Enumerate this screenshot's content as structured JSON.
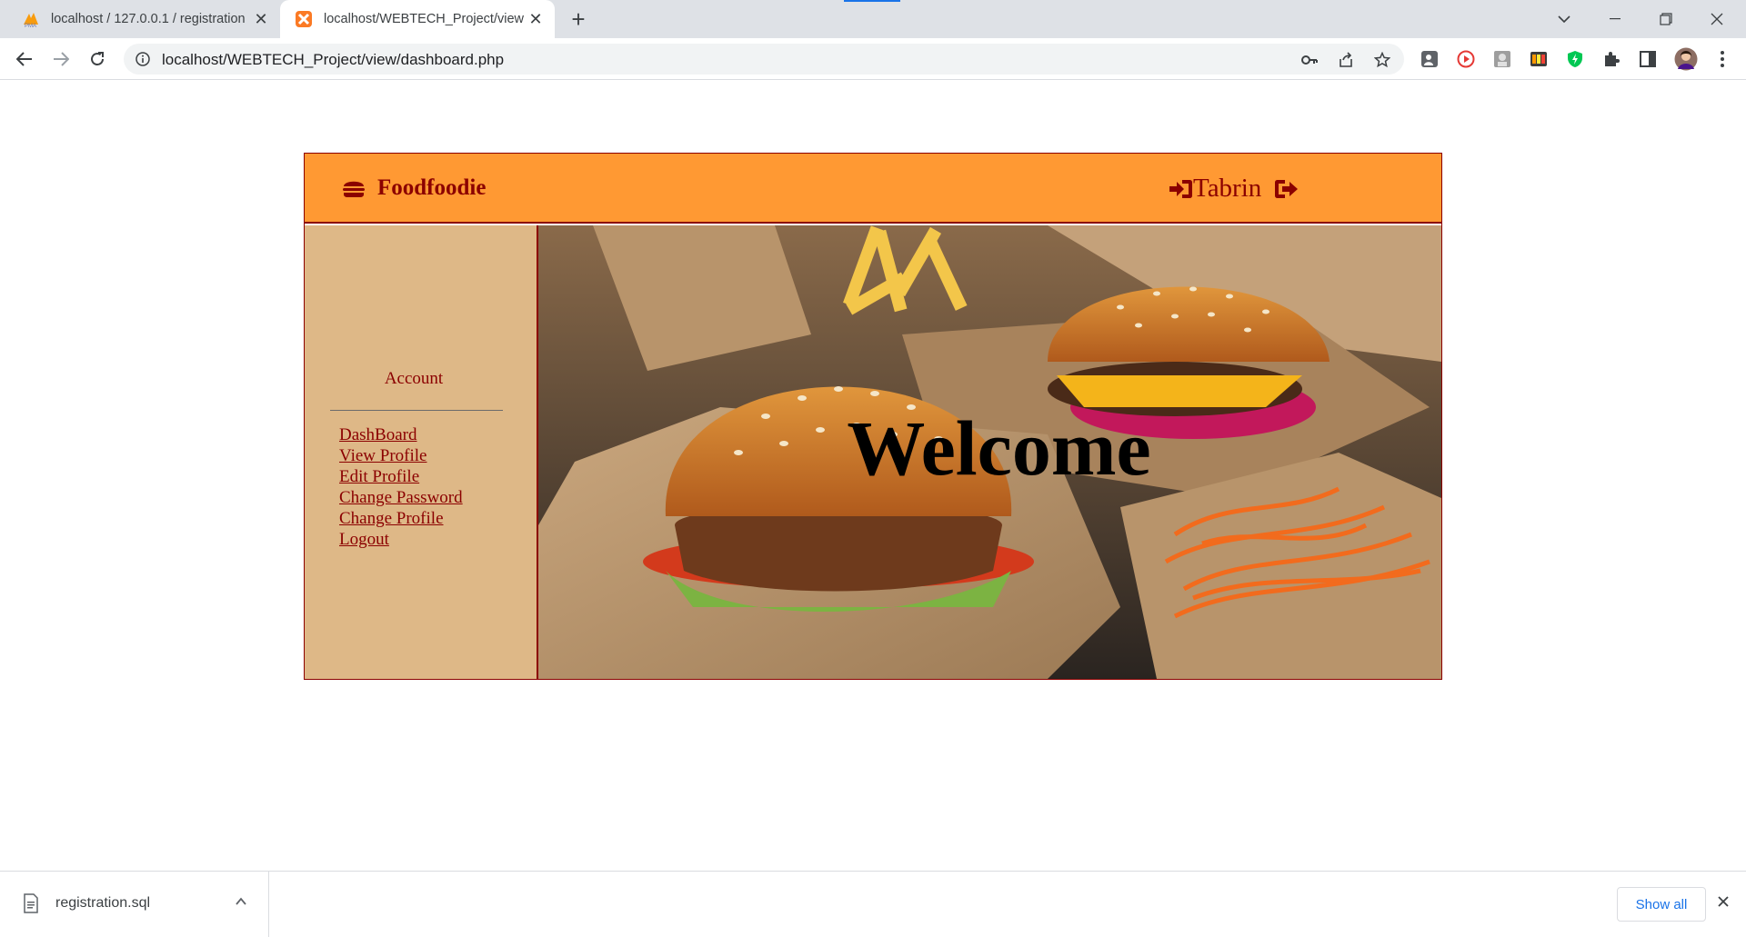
{
  "browser": {
    "tabs": [
      {
        "title": "localhost / 127.0.0.1 / registration",
        "favicon": "phpmyadmin-icon",
        "active": false
      },
      {
        "title": "localhost/WEBTECH_Project/view",
        "favicon": "xampp-icon",
        "active": true
      }
    ],
    "new_tab_label": "+",
    "url": "localhost/WEBTECH_Project/view/dashboard.php",
    "accent": "#1a73e8"
  },
  "site": {
    "brand_name": "Foodfoodie",
    "brand_icon": "burger-icon",
    "user_name": "Tabrin",
    "login_icon": "sign-in-icon",
    "logout_icon": "sign-out-icon",
    "colors": {
      "header": "#ff9933",
      "sidebar": "#deb887",
      "accent": "#8b0000"
    }
  },
  "sidebar": {
    "title": "Account",
    "links": [
      {
        "label": "DashBoard"
      },
      {
        "label": "View Profile"
      },
      {
        "label": "Edit Profile"
      },
      {
        "label": "Change Password"
      },
      {
        "label": "Change Profile"
      },
      {
        "label": "Logout"
      }
    ]
  },
  "main": {
    "heading": "Welcome",
    "image": "burgers-in-kraft-boxes"
  },
  "downloads": {
    "file_name": "registration.sql",
    "show_all_label": "Show all"
  }
}
